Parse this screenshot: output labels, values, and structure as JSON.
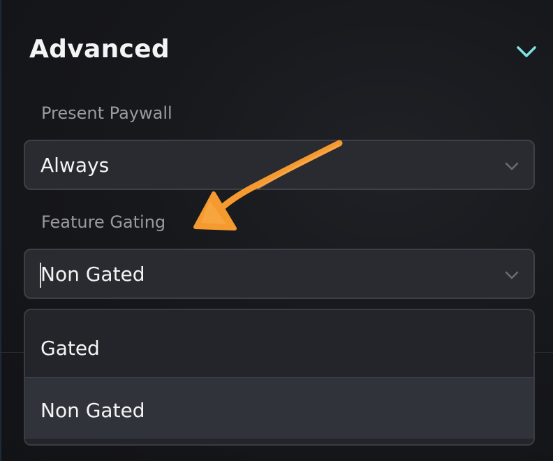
{
  "section": {
    "title": "Advanced",
    "toggle_icon": "chevron-down-icon",
    "accent_color": "#7fe3e6"
  },
  "present_paywall": {
    "label": "Present Paywall",
    "value": "Always",
    "chevron_icon": "chevron-down-icon"
  },
  "feature_gating": {
    "label": "Feature Gating",
    "value": "Non Gated",
    "chevron_icon": "chevron-down-icon",
    "options": [
      {
        "label": "Gated",
        "highlighted": false
      },
      {
        "label": "Non Gated",
        "highlighted": true
      }
    ]
  },
  "annotation": {
    "icon": "arrow-annotation-icon",
    "color": "#f59a2f"
  }
}
